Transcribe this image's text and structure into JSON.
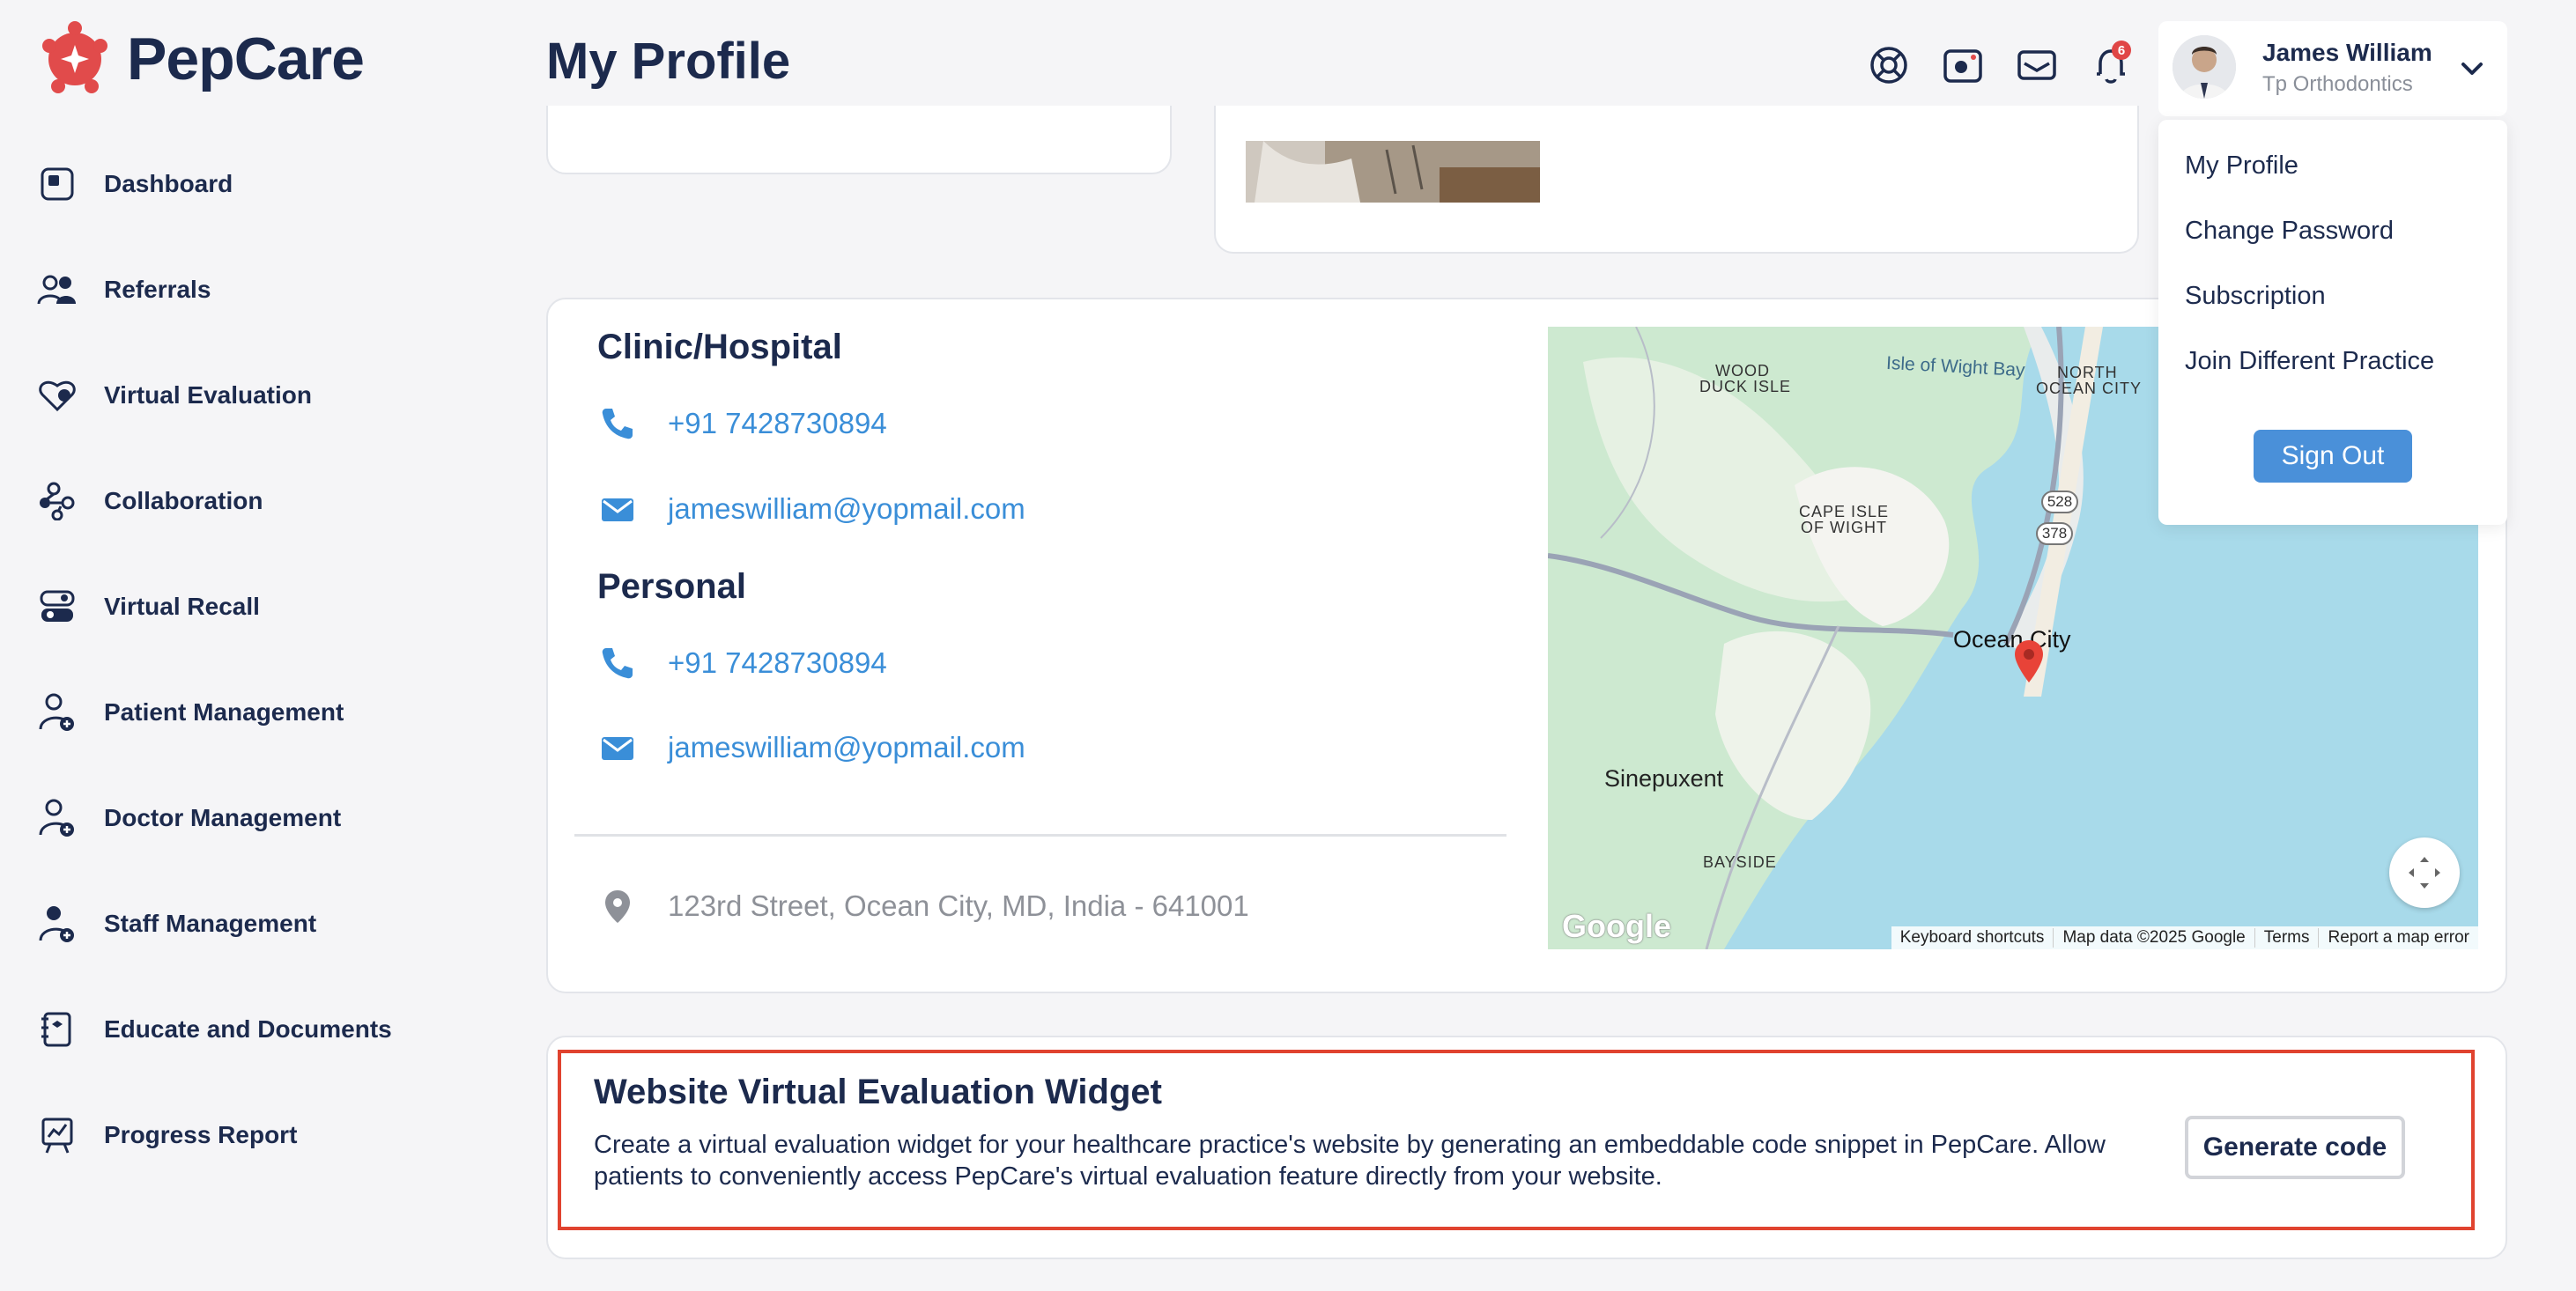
{
  "brand": {
    "name": "PepCare",
    "color": "#e14b4b"
  },
  "sidebar": {
    "items": [
      {
        "label": "Dashboard",
        "icon": "dashboard-icon"
      },
      {
        "label": "Referrals",
        "icon": "users-icon"
      },
      {
        "label": "Virtual Evaluation",
        "icon": "heart-search-icon"
      },
      {
        "label": "Collaboration",
        "icon": "share-nodes-icon"
      },
      {
        "label": "Virtual Recall",
        "icon": "toggle-icon"
      },
      {
        "label": "Patient Management",
        "icon": "user-plus-icon"
      },
      {
        "label": "Doctor Management",
        "icon": "user-plus-icon"
      },
      {
        "label": "Staff Management",
        "icon": "user-plus-icon"
      },
      {
        "label": "Educate and Documents",
        "icon": "document-icon"
      },
      {
        "label": "Progress Report",
        "icon": "chart-board-icon"
      }
    ]
  },
  "header": {
    "title": "My Profile",
    "icons": [
      "support-icon",
      "camera-icon",
      "mail-icon",
      "bell-icon"
    ],
    "notification_count": "6",
    "user": {
      "name": "James William",
      "org": "Tp Orthodontics"
    }
  },
  "dropdown": {
    "items": [
      "My Profile",
      "Change Password",
      "Subscription",
      "Join Different Practice"
    ],
    "signout": "Sign Out"
  },
  "contact": {
    "clinic_title": "Clinic/Hospital",
    "clinic_phone": "+91 7428730894",
    "clinic_email": "jameswilliam@yopmail.com",
    "personal_title": "Personal",
    "personal_phone": "+91 7428730894",
    "personal_email": "jameswilliam@yopmail.com",
    "address": "123rd Street, Ocean City, MD, India - 641001"
  },
  "map": {
    "labels": {
      "wood": "WOOD",
      "duck": "DUCK ISLE",
      "isle_bay": "Isle of Wight Bay",
      "north": "NORTH",
      "ocean_city_caps": "OCEAN CITY",
      "cape": "CAPE ISLE",
      "of_wight": "OF WIGHT",
      "route1": "528",
      "route2": "378",
      "ocean_city": "Ocean City",
      "sinepuxent": "Sinepuxent",
      "bayside": "BAYSIDE",
      "google": "Google"
    },
    "footer": {
      "shortcuts": "Keyboard shortcuts",
      "data": "Map data ©2025 Google",
      "terms": "Terms",
      "report": "Report a map error"
    }
  },
  "widget": {
    "title": "Website Virtual Evaluation Widget",
    "description": "Create a virtual evaluation widget for your healthcare practice's website by generating an embeddable code snippet in PepCare. Allow patients to conveniently access PepCare's virtual evaluation feature directly from your website.",
    "button": "Generate code"
  }
}
